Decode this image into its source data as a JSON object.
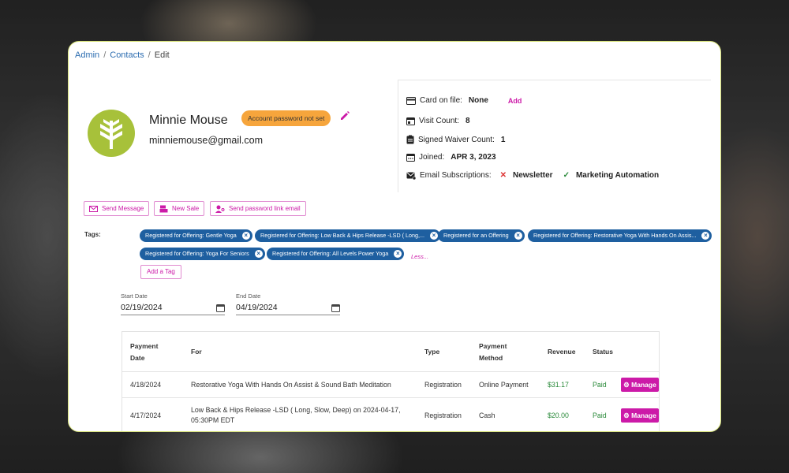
{
  "breadcrumb": {
    "items": [
      "Admin",
      "Contacts",
      "Edit"
    ]
  },
  "contact": {
    "name": "Minnie Mouse",
    "email": "minniemouse@gmail.com",
    "password_badge": "Account password not set"
  },
  "info": {
    "card_label": "Card on file:",
    "card_value": "None",
    "card_add": "Add",
    "visit_label": "Visit Count:",
    "visit_value": "8",
    "waiver_label": "Signed Waiver Count:",
    "waiver_value": "1",
    "joined_label": "Joined:",
    "joined_value": "APR 3, 2023",
    "subs_label": "Email Subscriptions:",
    "subs_newsletter": "Newsletter",
    "subs_marketing": "Marketing Automation"
  },
  "actions": {
    "send_message": "Send Message",
    "new_sale": "New Sale",
    "send_password": "Send password link email"
  },
  "tags": {
    "label": "Tags:",
    "items": [
      "Registered for Offering: Gentle Yoga",
      "Registered for Offering: Low Back & Hips Release -LSD ( Long,...",
      "Registered for an Offering",
      "Registered for Offering: Restorative Yoga With Hands On Assis...",
      "Registered for Offering: Yoga For Seniors",
      "Registered for Offering: All Levels Power Yoga"
    ],
    "less": "Less...",
    "add_tag": "Add a Tag"
  },
  "filters": {
    "start_label": "Start Date",
    "start_value": "02/19/2024",
    "end_label": "End Date",
    "end_value": "04/19/2024"
  },
  "table": {
    "headers": [
      "Payment Date",
      "For",
      "Type",
      "Payment Method",
      "Revenue",
      "Status"
    ],
    "rows": [
      {
        "date": "4/18/2024",
        "for": "Restorative Yoga With Hands On Assist & Sound Bath Meditation",
        "type": "Registration",
        "method": "Online Payment",
        "revenue": "$31.17",
        "status": "Paid",
        "action": "Manage"
      },
      {
        "date": "4/17/2024",
        "for": "Low Back & Hips Release -LSD ( Long, Slow, Deep) on 2024-04-17, 05:30PM EDT",
        "type": "Registration",
        "method": "Cash",
        "revenue": "$20.00",
        "status": "Paid",
        "action": "Manage"
      }
    ]
  },
  "colors": {
    "accent": "#cc1aa8",
    "tag_bg": "#1e5fa0",
    "badge_bg": "#f6a53c",
    "avatar_bg": "#a7c13a"
  },
  "icons": [
    "credit-card-icon",
    "calendar-icon",
    "clipboard-icon",
    "calendar-icon",
    "mail-check-icon",
    "pencil-icon",
    "envelope-icon",
    "register-icon",
    "user-key-icon",
    "gear-icon",
    "leaf-logo-icon"
  ]
}
